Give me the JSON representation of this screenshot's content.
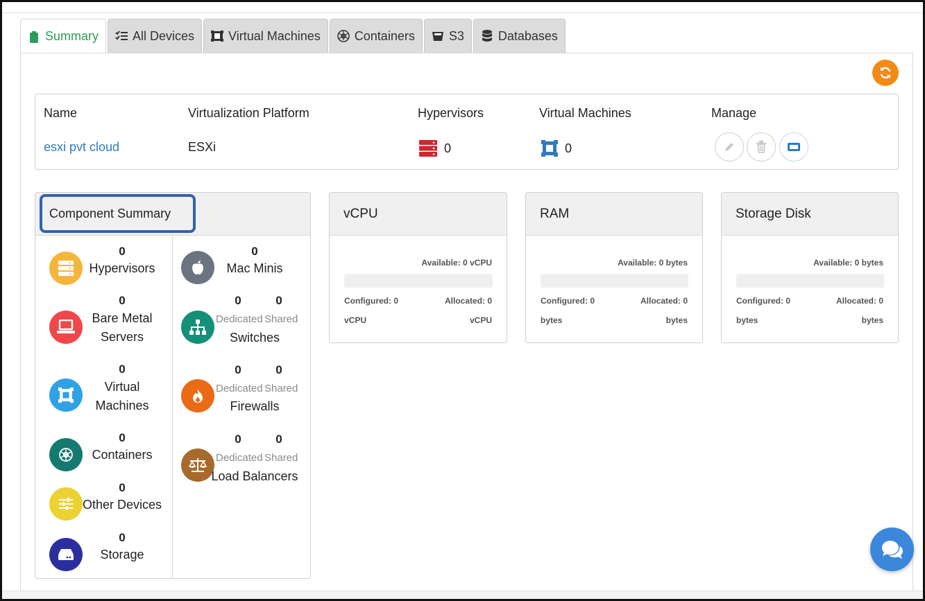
{
  "tabs": [
    {
      "label": "Summary",
      "icon": "clipboard-icon"
    },
    {
      "label": "All Devices",
      "icon": "list-check-icon"
    },
    {
      "label": "Virtual Machines",
      "icon": "vm-icon"
    },
    {
      "label": "Containers",
      "icon": "helm-icon"
    },
    {
      "label": "S3",
      "icon": "bucket-icon"
    },
    {
      "label": "Databases",
      "icon": "database-icon"
    }
  ],
  "cloud_table": {
    "headers": [
      "Name",
      "Virtualization Platform",
      "Hypervisors",
      "Virtual Machines",
      "Manage"
    ],
    "row": {
      "name": "esxi pvt cloud",
      "platform": "ESXi",
      "hypervisors": "0",
      "virtual_machines": "0"
    }
  },
  "component_summary": {
    "title": "Component Summary",
    "left": [
      {
        "count": "0",
        "label": "Hypervisors",
        "color": "#f4b63a",
        "icon": "server-icon"
      },
      {
        "count": "0",
        "label": "Bare Metal Servers",
        "color": "#f0474b",
        "icon": "laptop-icon"
      },
      {
        "count": "0",
        "label": "Virtual Machines",
        "color": "#2fa2e6",
        "icon": "vm-icon"
      },
      {
        "count": "0",
        "label": "Containers",
        "color": "#147a6f",
        "icon": "helm-icon"
      },
      {
        "count": "0",
        "label": "Other Devices",
        "color": "#ecd232",
        "icon": "sliders-icon"
      },
      {
        "count": "0",
        "label": "Storage",
        "color": "#2b2f9e",
        "icon": "hdd-icon"
      }
    ],
    "right": [
      {
        "label": "Mac Minis",
        "color": "#6b7580",
        "icon": "apple-icon",
        "count": "0"
      },
      {
        "label": "Switches",
        "color": "#149079",
        "icon": "sitemap-icon",
        "dedicated_count": "0",
        "shared_count": "0"
      },
      {
        "label": "Firewalls",
        "color": "#eb6a16",
        "icon": "fire-icon",
        "dedicated_count": "0",
        "shared_count": "0"
      },
      {
        "label": "Load Balancers",
        "color": "#a86a2c",
        "icon": "balance-icon",
        "dedicated_count": "0",
        "shared_count": "0"
      }
    ],
    "dedicated_label": "Dedicated",
    "shared_label": "Shared"
  },
  "resources": [
    {
      "title": "vCPU",
      "available": "Available: 0 vCPU",
      "configured": "Configured: 0",
      "allocated": "Allocated: 0",
      "unit_left": "vCPU",
      "unit_right": "vCPU",
      "used_fraction": 0
    },
    {
      "title": "RAM",
      "available": "Available: 0 bytes",
      "configured": "Configured: 0",
      "allocated": "Allocated: 0",
      "unit_left": "bytes",
      "unit_right": "bytes",
      "used_fraction": 0
    },
    {
      "title": "Storage Disk",
      "available": "Available: 0 bytes",
      "configured": "Configured: 0",
      "allocated": "Allocated: 0",
      "unit_left": "bytes",
      "unit_right": "bytes",
      "used_fraction": 0
    }
  ],
  "colors": {
    "active_tab": "#2c9c5a",
    "link": "#2f7bc0",
    "refresh": "#f48a16",
    "chat": "#3a87dc",
    "hypervisor_icon": "#d0262e",
    "vm_icon": "#2f7bc0",
    "highlight_box": "#3561ae"
  }
}
